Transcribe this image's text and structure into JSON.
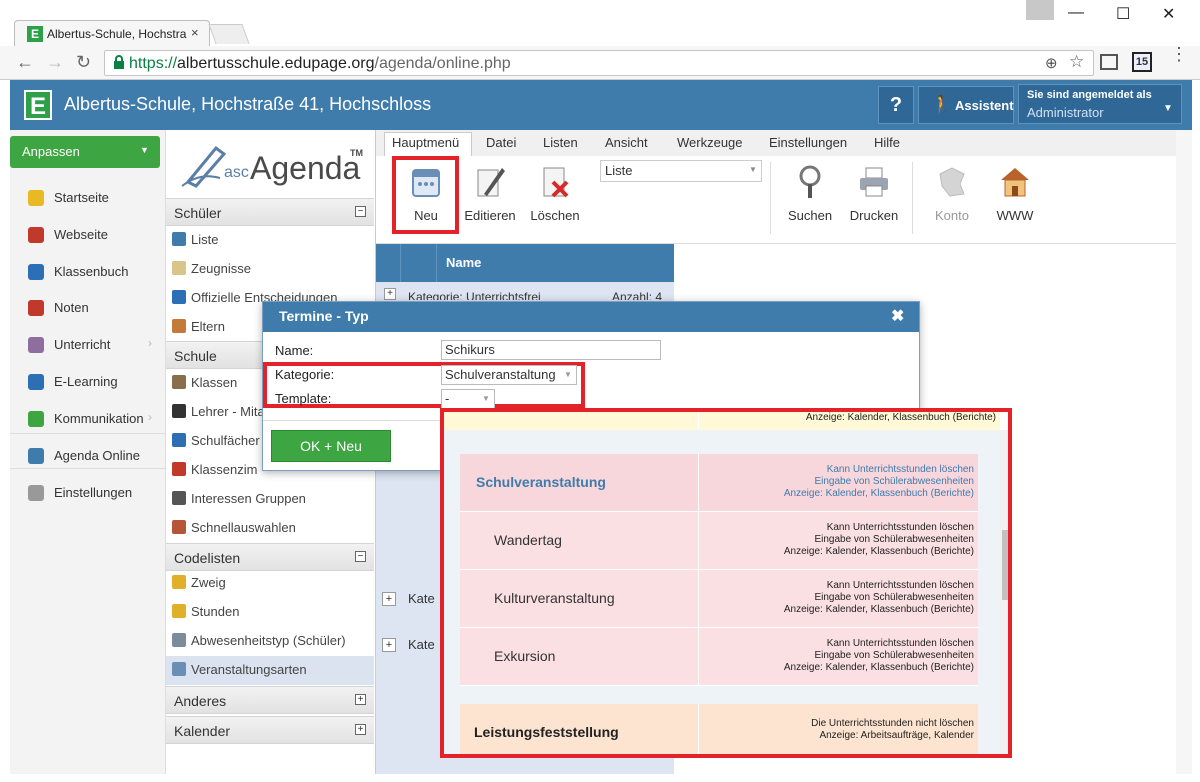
{
  "browser": {
    "tab_title": "Albertus-Schule, Hochstra",
    "tab_close": "×",
    "url_scheme": "https://",
    "url_host": "albertusschule.edupage.org",
    "url_path": "/agenda/online.php",
    "calendar_badge": "15"
  },
  "header": {
    "school_name": "Albertus-Schule, Hochstraße 41, Hochschloss",
    "help": "?",
    "assistant": "Assistent",
    "logged_in_label": "Sie sind angemeldet als",
    "user": "Administrator"
  },
  "sidebar": {
    "anpassen": "Anpassen",
    "items": [
      {
        "label": "Startseite",
        "color": "#e8b923"
      },
      {
        "label": "Webseite",
        "color": "#c0392b"
      },
      {
        "label": "Klassenbuch",
        "color": "#2c6fb4"
      },
      {
        "label": "Noten",
        "color": "#c0392b"
      },
      {
        "label": "Unterricht",
        "color": "#8e6e9e"
      },
      {
        "label": "E-Learning",
        "color": "#2c6fb4"
      },
      {
        "label": "Kommunikation",
        "color": "#3da643"
      },
      {
        "label": "Agenda Online",
        "color": "#3f7cac"
      },
      {
        "label": "Einstellungen",
        "color": "#999999"
      }
    ]
  },
  "col2": {
    "logo_prefix": "asc",
    "logo_text": "Agenda",
    "logo_tm": "TM",
    "sections": {
      "schueler": "Schüler",
      "schule": "Schule",
      "codelisten": "Codelisten",
      "anderes": "Anderes",
      "kalender": "Kalender"
    },
    "schueler_items": [
      "Liste",
      "Zeugnisse",
      "Offizielle Entscheidungen",
      "Eltern"
    ],
    "schule_items": [
      "Klassen",
      "Lehrer - Mita",
      "Schulfächer",
      "Klassenzim",
      "Interessen Gruppen",
      "Schnellauswahlen"
    ],
    "codelisten_items": [
      "Zweig",
      "Stunden",
      "Abwesenheitstyp (Schüler)",
      "Veranstaltungsarten"
    ]
  },
  "ribbon": {
    "tabs": [
      "Hauptmenü",
      "Datei",
      "Listen",
      "Ansicht",
      "Werkzeuge",
      "Einstellungen",
      "Hilfe"
    ],
    "buttons": {
      "neu": "Neu",
      "edit": "Editieren",
      "delete": "Löschen",
      "search": "Suchen",
      "print": "Drucken",
      "konto": "Konto",
      "www": "WWW"
    },
    "list_select": "Liste"
  },
  "grid": {
    "header": "Name",
    "row1_text": "Kategorie: Unterrichtsfrei",
    "row1_count": "Anzahl: 4",
    "row_kate": "Kate"
  },
  "dialog": {
    "title": "Termine - Typ",
    "close": "✖",
    "name_label": "Name:",
    "name_value": "Schikurs",
    "kategorie_label": "Kategorie:",
    "kategorie_value": "Schulveranstaltung",
    "template_label": "Template:",
    "template_value": "-",
    "ok_button": "OK + Neu"
  },
  "dropdown": {
    "top_desc": "Anzeige: Kalender, Klassenbuch (Berichte)",
    "rows": [
      {
        "name": "Schulveranstaltung",
        "l1": "Kann Unterrichtsstunden löschen",
        "l2": "Eingabe von Schülerabwesenheiten",
        "l3": "Anzeige: Kalender, Klassenbuch (Berichte)"
      },
      {
        "name": "Wandertag",
        "l1": "Kann Unterrichtsstunden löschen",
        "l2": "Eingabe von Schülerabwesenheiten",
        "l3": "Anzeige: Kalender, Klassenbuch (Berichte)"
      },
      {
        "name": "Kulturveranstaltung",
        "l1": "Kann Unterrichtsstunden löschen",
        "l2": "Eingabe von Schülerabwesenheiten",
        "l3": "Anzeige: Kalender, Klassenbuch (Berichte)"
      },
      {
        "name": "Exkursion",
        "l1": "Kann Unterrichtsstunden löschen",
        "l2": "Eingabe von Schülerabwesenheiten",
        "l3": "Anzeige: Kalender, Klassenbuch (Berichte)"
      },
      {
        "name": "Leistungsfeststellung",
        "l1": "Die Unterrichtsstunden nicht löschen",
        "l2": "Anzeige: Arbeitsaufträge, Kalender",
        "l3": ""
      }
    ]
  }
}
